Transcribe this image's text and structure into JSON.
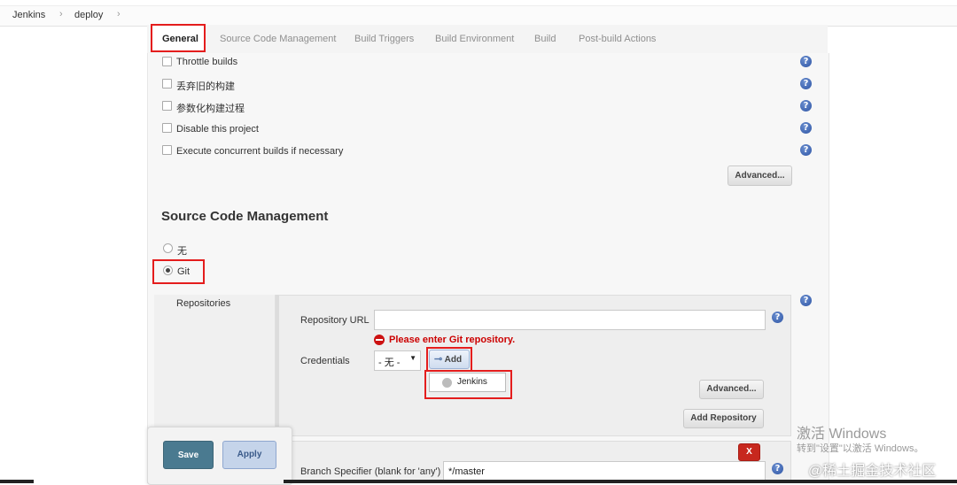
{
  "breadcrumb": {
    "items": [
      "Jenkins",
      "deploy"
    ],
    "separator": "›"
  },
  "tabs": [
    {
      "label": "General",
      "active": true
    },
    {
      "label": "Source Code Management",
      "active": false
    },
    {
      "label": "Build Triggers",
      "active": false
    },
    {
      "label": "Build Environment",
      "active": false
    },
    {
      "label": "Build",
      "active": false
    },
    {
      "label": "Post-build Actions",
      "active": false
    }
  ],
  "general": {
    "options": [
      {
        "label": "Throttle builds",
        "checked": false
      },
      {
        "label": "丢弃旧的构建",
        "checked": false
      },
      {
        "label": "参数化构建过程",
        "checked": false
      },
      {
        "label": "Disable this project",
        "checked": false
      },
      {
        "label": "Execute concurrent builds if necessary",
        "checked": false
      }
    ],
    "advanced_label": "Advanced..."
  },
  "scm": {
    "title": "Source Code Management",
    "options": [
      {
        "label": "无",
        "selected": false
      },
      {
        "label": "Git",
        "selected": true
      }
    ],
    "repositories_label": "Repositories",
    "repo_url_label": "Repository URL",
    "repo_url_value": "",
    "repo_url_error": "Please enter Git repository.",
    "credentials_label": "Credentials",
    "credentials_selected": "- 无 -",
    "add_label": "Add",
    "add_menu": [
      "Jenkins"
    ],
    "advanced_label": "Advanced...",
    "add_repository_label": "Add Repository",
    "delete_label": "X",
    "branch_label": "Branch Specifier (blank for 'any')",
    "branch_value": "*/master"
  },
  "footer": {
    "save_label": "Save",
    "apply_label": "Apply"
  },
  "help_icon": "?",
  "watermarks": {
    "windows_title": "激活 Windows",
    "windows_sub": "转到\"设置\"以激活 Windows。",
    "site": "@稀土掘金技术社区"
  },
  "colors": {
    "highlight": "#e41d1d",
    "error": "#cc0000",
    "save_button": "#4a7a90",
    "apply_button": "#c5d4ea"
  }
}
